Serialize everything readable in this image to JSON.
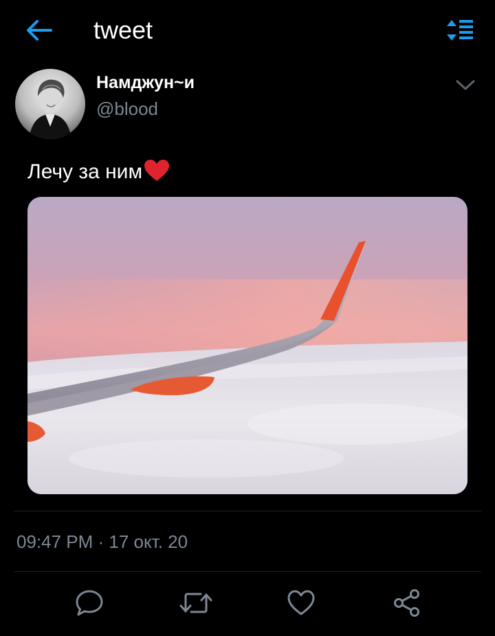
{
  "header": {
    "title": "tweet",
    "back_icon": "arrow-left-icon",
    "sort_icon": "sort-lines-icon",
    "accent_color": "#1d9bf0"
  },
  "tweet": {
    "author": {
      "name": "Намджун~и",
      "handle": "@blood",
      "avatar": "avatar-photo"
    },
    "text": "Лечу за ним",
    "emoji": "red-heart-emoji",
    "media": "photo of airplane wing above clouds at sunset",
    "timestamp": "09:47 PM · 17 окт. 20"
  },
  "actions": {
    "reply_icon": "reply-bubble-icon",
    "retweet_icon": "retweet-icon",
    "like_icon": "heart-outline-icon",
    "share_icon": "share-icon"
  },
  "colors": {
    "background": "#000000",
    "secondary_text": "#7c8894",
    "divider": "#1c2329"
  }
}
